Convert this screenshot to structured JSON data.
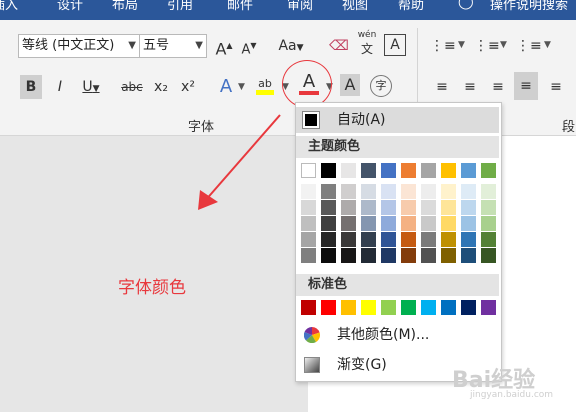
{
  "titlebar": {
    "tabs": [
      "插入",
      "设计",
      "布局",
      "引用",
      "邮件",
      "审阅",
      "视图",
      "帮助"
    ],
    "tell_me": "操作说明搜索"
  },
  "ribbon": {
    "font_name": "等线 (中文正文)",
    "font_size": "五号",
    "group_font_label": "字体",
    "group_paragraph_label": "段",
    "pinyin_label": "wén",
    "btn_bold": "B",
    "btn_italic": "I",
    "btn_underline": "U",
    "btn_strike": "abc",
    "btn_sub": "x₂",
    "btn_sup": "x²",
    "btn_grow": "A",
    "btn_shrink": "A",
    "btn_case": "Aa",
    "btn_border": "A",
    "btn_font_color": "A",
    "btn_shading": "A",
    "btn_enclose": "字",
    "btn_highlight": "ab"
  },
  "annotation": {
    "text": "字体颜色",
    "color": "#e8383d"
  },
  "dropdown": {
    "auto_label": "自动(A)",
    "theme_header": "主题颜色",
    "standard_header": "标准色",
    "more_colors": "其他颜色(M)...",
    "gradient": "渐变(G)",
    "theme_top": [
      "#ffffff",
      "#000000",
      "#e7e6e6",
      "#44546a",
      "#4472c4",
      "#ed7d31",
      "#a5a5a5",
      "#ffc000",
      "#5b9bd5",
      "#70ad47"
    ],
    "theme_shades": [
      [
        "#f2f2f2",
        "#7f7f7f",
        "#d0cece",
        "#d6dce4",
        "#d9e2f3",
        "#fbe5d5",
        "#ededed",
        "#fff2cc",
        "#deebf6",
        "#e2efd9"
      ],
      [
        "#d8d8d8",
        "#595959",
        "#aeabab",
        "#adb9ca",
        "#b4c6e7",
        "#f7cbac",
        "#dbdbdb",
        "#fee599",
        "#bdd7ee",
        "#c5e0b3"
      ],
      [
        "#bfbfbf",
        "#3f3f3f",
        "#757070",
        "#8496b0",
        "#8eaadb",
        "#f4b183",
        "#c9c9c9",
        "#ffd965",
        "#9cc3e5",
        "#a8d08d"
      ],
      [
        "#a5a5a5",
        "#262626",
        "#3a3838",
        "#323f4f",
        "#2f5496",
        "#c55a11",
        "#7b7b7b",
        "#bf9000",
        "#2e75b5",
        "#538135"
      ],
      [
        "#7f7f7f",
        "#0c0c0c",
        "#171616",
        "#222a35",
        "#1f3864",
        "#833c0b",
        "#525252",
        "#7f6000",
        "#1e4e79",
        "#375623"
      ]
    ],
    "standard": [
      "#c00000",
      "#ff0000",
      "#ffc000",
      "#ffff00",
      "#92d050",
      "#00b050",
      "#00b0f0",
      "#0070c0",
      "#002060",
      "#7030a0"
    ]
  },
  "watermark": {
    "text": "Bai经验",
    "sub": "jingyan.baidu.com"
  }
}
